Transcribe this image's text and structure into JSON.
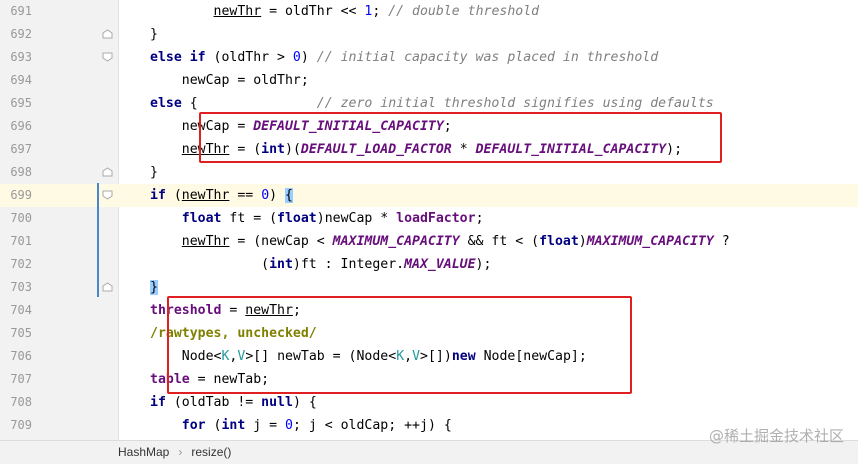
{
  "editor": {
    "lines": [
      {
        "num": "691",
        "tokens": [
          {
            "t": "        "
          },
          {
            "t": "newThr",
            "c": "ul"
          },
          {
            "t": " = oldThr << "
          },
          {
            "t": "1",
            "c": "num"
          },
          {
            "t": "; "
          },
          {
            "t": "// double threshold",
            "c": "cm"
          }
        ]
      },
      {
        "num": "692",
        "tokens": [
          {
            "t": "}"
          }
        ]
      },
      {
        "num": "693",
        "tokens": [
          {
            "t": "else if",
            "c": "kw"
          },
          {
            "t": " (oldThr > "
          },
          {
            "t": "0",
            "c": "num"
          },
          {
            "t": ") "
          },
          {
            "t": "// initial capacity was placed in threshold",
            "c": "cm"
          }
        ]
      },
      {
        "num": "694",
        "tokens": [
          {
            "t": "    newCap = oldThr;"
          }
        ]
      },
      {
        "num": "695",
        "tokens": [
          {
            "t": "else",
            "c": "kw"
          },
          {
            "t": " {               "
          },
          {
            "t": "// zero initial threshold signifies using defaults",
            "c": "cm"
          }
        ]
      },
      {
        "num": "696",
        "tokens": [
          {
            "t": "    newCap = "
          },
          {
            "t": "DEFAULT_INITIAL_CAPACITY",
            "c": "cst"
          },
          {
            "t": ";"
          }
        ]
      },
      {
        "num": "697",
        "tokens": [
          {
            "t": "    "
          },
          {
            "t": "newThr",
            "c": "ul"
          },
          {
            "t": " = ("
          },
          {
            "t": "int",
            "c": "kw"
          },
          {
            "t": ")("
          },
          {
            "t": "DEFAULT_LOAD_FACTOR",
            "c": "cst"
          },
          {
            "t": " * "
          },
          {
            "t": "DEFAULT_INITIAL_CAPACITY",
            "c": "cst"
          },
          {
            "t": ");"
          }
        ]
      },
      {
        "num": "698",
        "tokens": [
          {
            "t": "}"
          }
        ]
      },
      {
        "num": "699",
        "tokens": [
          {
            "t": "if",
            "c": "kw"
          },
          {
            "t": " ("
          },
          {
            "t": "newThr",
            "c": "ul"
          },
          {
            "t": " == "
          },
          {
            "t": "0",
            "c": "num"
          },
          {
            "t": ") "
          },
          {
            "t": "{",
            "c": "brmatch"
          }
        ]
      },
      {
        "num": "700",
        "tokens": [
          {
            "t": "    "
          },
          {
            "t": "float",
            "c": "kw"
          },
          {
            "t": " ft = ("
          },
          {
            "t": "float",
            "c": "kw"
          },
          {
            "t": ")newCap * "
          },
          {
            "t": "loadFactor",
            "c": "fld"
          },
          {
            "t": ";"
          }
        ]
      },
      {
        "num": "701",
        "tokens": [
          {
            "t": "    "
          },
          {
            "t": "newThr",
            "c": "ul"
          },
          {
            "t": " = (newCap < "
          },
          {
            "t": "MAXIMUM_CAPACITY",
            "c": "cst"
          },
          {
            "t": " && ft < ("
          },
          {
            "t": "float",
            "c": "kw"
          },
          {
            "t": ")"
          },
          {
            "t": "MAXIMUM_CAPACITY",
            "c": "cst"
          },
          {
            "t": " ?"
          }
        ]
      },
      {
        "num": "702",
        "tokens": [
          {
            "t": "              ("
          },
          {
            "t": "int",
            "c": "kw"
          },
          {
            "t": ")ft : Integer."
          },
          {
            "t": "MAX_VALUE",
            "c": "cst"
          },
          {
            "t": ");"
          }
        ]
      },
      {
        "num": "703",
        "tokens": [
          {
            "t": "}",
            "c": "brmatch"
          }
        ]
      },
      {
        "num": "704",
        "tokens": [
          {
            "t": "threshold",
            "c": "fld"
          },
          {
            "t": " = "
          },
          {
            "t": "newThr",
            "c": "ul"
          },
          {
            "t": ";"
          }
        ]
      },
      {
        "num": "705",
        "tokens": [
          {
            "t": "/rawtypes, unchecked/",
            "c": "ann"
          }
        ]
      },
      {
        "num": "706",
        "tokens": [
          {
            "t": "    Node<"
          },
          {
            "t": "K",
            "c": "tp"
          },
          {
            "t": ","
          },
          {
            "t": "V",
            "c": "tp"
          },
          {
            "t": ">[] newTab = (Node<"
          },
          {
            "t": "K",
            "c": "tp"
          },
          {
            "t": ","
          },
          {
            "t": "V",
            "c": "tp"
          },
          {
            "t": ">[])"
          },
          {
            "t": "new",
            "c": "kw"
          },
          {
            "t": " Node[newCap];"
          }
        ]
      },
      {
        "num": "707",
        "tokens": [
          {
            "t": "table",
            "c": "fld"
          },
          {
            "t": " = newTab;"
          }
        ]
      },
      {
        "num": "708",
        "tokens": [
          {
            "t": "if",
            "c": "kw"
          },
          {
            "t": " (oldTab != "
          },
          {
            "t": "null",
            "c": "kw"
          },
          {
            "t": ") {"
          }
        ]
      },
      {
        "num": "709",
        "tokens": [
          {
            "t": "    "
          },
          {
            "t": "for",
            "c": "kw"
          },
          {
            "t": " ("
          },
          {
            "t": "int",
            "c": "kw"
          },
          {
            "t": " j = "
          },
          {
            "t": "0",
            "c": "num"
          },
          {
            "t": "; j < oldCap; ++j) {"
          }
        ]
      }
    ],
    "current_line": "699"
  },
  "statusbar": {
    "class_name": "HashMap",
    "separator": "›",
    "method_name": "resize()"
  },
  "watermark": {
    "text": "@稀土掘金技术社区"
  },
  "colors": {
    "highlight_box": "#e02020",
    "keyword": "#000080",
    "comment": "#808080",
    "constant": "#660e7a",
    "number": "#0000ff",
    "type_param": "#20999d",
    "annotation": "#808000",
    "current_line_bg": "#fffae3"
  }
}
